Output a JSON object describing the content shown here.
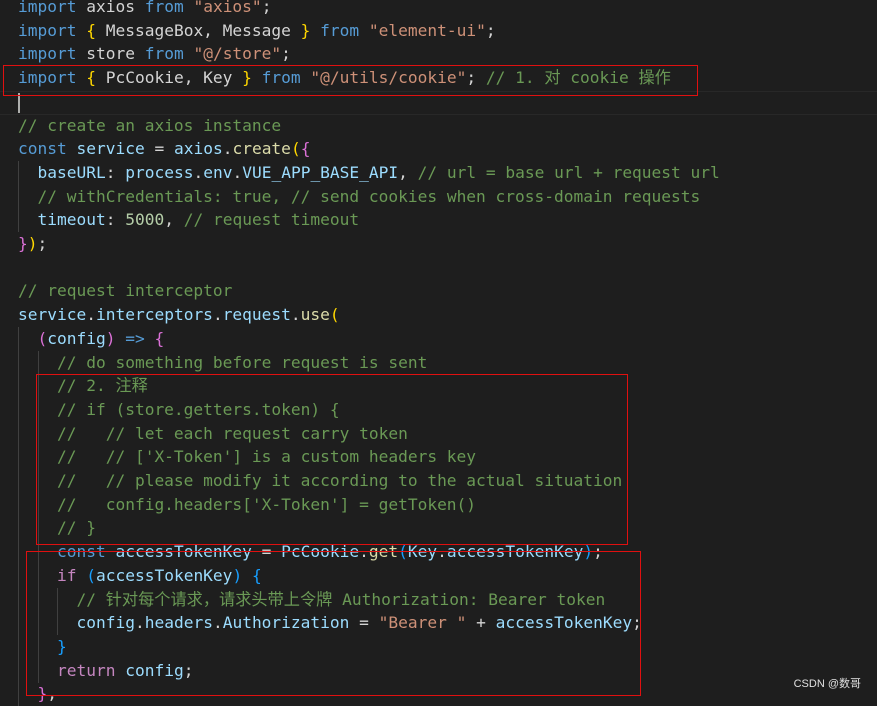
{
  "lines": [
    [
      [
        "kw",
        "import"
      ],
      [
        "txt",
        " axios "
      ],
      [
        "kw",
        "from"
      ],
      [
        "txt",
        " "
      ],
      [
        "str",
        "\"axios\""
      ],
      [
        "txt",
        ";"
      ]
    ],
    [
      [
        "kw",
        "import"
      ],
      [
        "txt",
        " "
      ],
      [
        "br1",
        "{"
      ],
      [
        "txt",
        " MessageBox, Message "
      ],
      [
        "br1",
        "}"
      ],
      [
        "txt",
        " "
      ],
      [
        "kw",
        "from"
      ],
      [
        "txt",
        " "
      ],
      [
        "str",
        "\"element-ui\""
      ],
      [
        "txt",
        ";"
      ]
    ],
    [
      [
        "kw",
        "import"
      ],
      [
        "txt",
        " store "
      ],
      [
        "kw",
        "from"
      ],
      [
        "txt",
        " "
      ],
      [
        "str",
        "\"@/store\""
      ],
      [
        "txt",
        ";"
      ]
    ],
    [
      [
        "kw",
        "import"
      ],
      [
        "txt",
        " "
      ],
      [
        "br1",
        "{"
      ],
      [
        "txt",
        " PcCookie, Key "
      ],
      [
        "br1",
        "}"
      ],
      [
        "txt",
        " "
      ],
      [
        "kw",
        "from"
      ],
      [
        "txt",
        " "
      ],
      [
        "str",
        "\"@/utils/cookie\""
      ],
      [
        "txt",
        "; "
      ],
      [
        "cm",
        "// 1. 对 cookie 操作"
      ]
    ],
    [],
    [
      [
        "cm",
        "// create an axios instance"
      ]
    ],
    [
      [
        "kw",
        "const"
      ],
      [
        "txt",
        " "
      ],
      [
        "var",
        "service"
      ],
      [
        "txt",
        " = "
      ],
      [
        "var",
        "axios"
      ],
      [
        "txt",
        "."
      ],
      [
        "fn",
        "create"
      ],
      [
        "br1",
        "("
      ],
      [
        "br2",
        "{"
      ]
    ],
    [
      [
        "txt",
        "  "
      ],
      [
        "var",
        "baseURL"
      ],
      [
        "txt",
        ": "
      ],
      [
        "var",
        "process"
      ],
      [
        "txt",
        "."
      ],
      [
        "var",
        "env"
      ],
      [
        "txt",
        "."
      ],
      [
        "var",
        "VUE_APP_BASE_API"
      ],
      [
        "txt",
        ", "
      ],
      [
        "cm",
        "// url = base url + request url"
      ]
    ],
    [
      [
        "txt",
        "  "
      ],
      [
        "cm",
        "// withCredentials: true, // send cookies when cross-domain requests"
      ]
    ],
    [
      [
        "txt",
        "  "
      ],
      [
        "var",
        "timeout"
      ],
      [
        "txt",
        ": "
      ],
      [
        "num",
        "5000"
      ],
      [
        "txt",
        ", "
      ],
      [
        "cm",
        "// request timeout"
      ]
    ],
    [
      [
        "br2",
        "}"
      ],
      [
        "br1",
        ")"
      ],
      [
        "txt",
        ";"
      ]
    ],
    [],
    [
      [
        "cm",
        "// request interceptor"
      ]
    ],
    [
      [
        "var",
        "service"
      ],
      [
        "txt",
        "."
      ],
      [
        "var",
        "interceptors"
      ],
      [
        "txt",
        "."
      ],
      [
        "var",
        "request"
      ],
      [
        "txt",
        "."
      ],
      [
        "fn",
        "use"
      ],
      [
        "br1",
        "("
      ]
    ],
    [
      [
        "txt",
        "  "
      ],
      [
        "br2",
        "("
      ],
      [
        "var",
        "config"
      ],
      [
        "br2",
        ")"
      ],
      [
        "txt",
        " "
      ],
      [
        "kw",
        "=>"
      ],
      [
        "txt",
        " "
      ],
      [
        "br2",
        "{"
      ]
    ],
    [
      [
        "txt",
        "    "
      ],
      [
        "cm",
        "// do something before request is sent"
      ]
    ],
    [
      [
        "txt",
        "    "
      ],
      [
        "cm",
        "// 2. 注释"
      ]
    ],
    [
      [
        "txt",
        "    "
      ],
      [
        "cm",
        "// if (store.getters.token) {"
      ]
    ],
    [
      [
        "txt",
        "    "
      ],
      [
        "cm",
        "//   // let each request carry token"
      ]
    ],
    [
      [
        "txt",
        "    "
      ],
      [
        "cm",
        "//   // ['X-Token'] is a custom headers key"
      ]
    ],
    [
      [
        "txt",
        "    "
      ],
      [
        "cm",
        "//   // please modify it according to the actual situation"
      ]
    ],
    [
      [
        "txt",
        "    "
      ],
      [
        "cm",
        "//   config.headers['X-Token'] = getToken()"
      ]
    ],
    [
      [
        "txt",
        "    "
      ],
      [
        "cm",
        "// }"
      ]
    ],
    [
      [
        "txt",
        "    "
      ],
      [
        "kw",
        "const"
      ],
      [
        "txt",
        " "
      ],
      [
        "var",
        "accessTokenKey"
      ],
      [
        "txt",
        " = "
      ],
      [
        "var",
        "PcCookie"
      ],
      [
        "txt",
        "."
      ],
      [
        "fn",
        "get"
      ],
      [
        "br3",
        "("
      ],
      [
        "var",
        "Key"
      ],
      [
        "txt",
        "."
      ],
      [
        "var",
        "accessTokenKey"
      ],
      [
        "br3",
        ")"
      ],
      [
        "txt",
        ";"
      ]
    ],
    [
      [
        "txt",
        "    "
      ],
      [
        "kc",
        "if"
      ],
      [
        "txt",
        " "
      ],
      [
        "br3",
        "("
      ],
      [
        "var",
        "accessTokenKey"
      ],
      [
        "br3",
        ")"
      ],
      [
        "txt",
        " "
      ],
      [
        "br3",
        "{"
      ]
    ],
    [
      [
        "txt",
        "      "
      ],
      [
        "cm",
        "// 针对每个请求，请求头带上令牌 Authorization: Bearer token"
      ]
    ],
    [
      [
        "txt",
        "      "
      ],
      [
        "var",
        "config"
      ],
      [
        "txt",
        "."
      ],
      [
        "var",
        "headers"
      ],
      [
        "txt",
        "."
      ],
      [
        "var",
        "Authorization"
      ],
      [
        "txt",
        " = "
      ],
      [
        "str",
        "\"Bearer \""
      ],
      [
        "txt",
        " + "
      ],
      [
        "var",
        "accessTokenKey"
      ],
      [
        "txt",
        ";"
      ]
    ],
    [
      [
        "txt",
        "    "
      ],
      [
        "br3",
        "}"
      ]
    ],
    [
      [
        "txt",
        "    "
      ],
      [
        "kc",
        "return"
      ],
      [
        "txt",
        " "
      ],
      [
        "var",
        "config"
      ],
      [
        "txt",
        ";"
      ]
    ],
    [
      [
        "txt",
        "  "
      ],
      [
        "br2",
        "}"
      ],
      [
        "txt",
        ","
      ]
    ]
  ],
  "watermark": "CSDN @数哥"
}
